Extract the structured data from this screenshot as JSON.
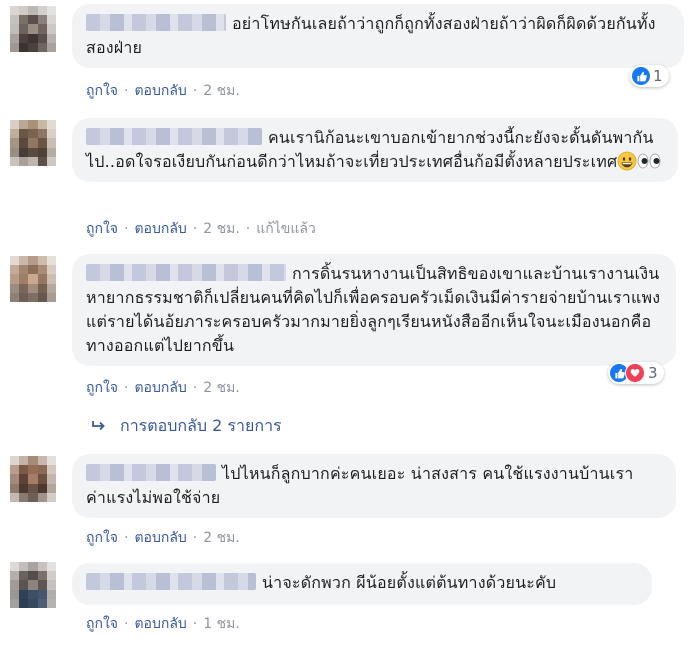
{
  "comments": [
    {
      "text": "อย่าโทษกันเลยถ้าว่าถูกก็ถูกทั้งสองฝ่ายถ้าว่าผิดก็ผิดด้วยกันทั้งสองฝ่าย",
      "like_label": "ถูกใจ",
      "reply_label": "ตอบกลับ",
      "time": "2 ชม.",
      "reaction_count": "1"
    },
    {
      "text": "คนเรานิก้อนะเขาบอกเข้ายากช่วงนี้กะยังจะดั้นดันพากันไป..อดใจรอเงียบกันก่อนดีกว่าไหมถ้าจะเที่ยวประเทศอื่นก้อมีตั้งหลายประเทศ",
      "like_label": "ถูกใจ",
      "reply_label": "ตอบกลับ",
      "time": "2 ชม.",
      "edited_label": "แก้ไขแล้ว"
    },
    {
      "text": "การดิ้นรนหางานเป็นสิทธิของเขาและบ้านเรางานเงินหายากธรรมชาติก็เปลี่ยนคนที่คิดไปก็เพื่อครอบครัวเม็ดเงินมีค่ารายจ่ายบ้านเราแพงแต่รายได้นอ้ยภาระครอบครัวมากมายยิ่งลูกๆเรียนหนังสืออีกเห็นใจนะเมืองนอกคือทางออกแต่ไปยากขึ้น",
      "like_label": "ถูกใจ",
      "reply_label": "ตอบกลับ",
      "time": "2 ชม.",
      "reaction_count": "3",
      "replies_label": "การตอบกลับ 2 รายการ"
    },
    {
      "text": "ไปไหนก็ลูกบากค่ะคนเยอะ น่าสงสาร คนใช้แรงงานบ้านเราค่าแรงไม่พอใช้จ่าย",
      "like_label": "ถูกใจ",
      "reply_label": "ตอบกลับ",
      "time": "2 ชม."
    },
    {
      "text": "น่าจะดักพวก ผีน้อยตั้งแต่ต้นทางด้วยนะคับ",
      "like_label": "ถูกใจ",
      "reply_label": "ตอบกลับ",
      "time": "1 ชม."
    }
  ],
  "colors": {
    "link": "#385898",
    "bubble": "#f2f3f5",
    "like": "#1877f2",
    "love": "#f33e58"
  }
}
